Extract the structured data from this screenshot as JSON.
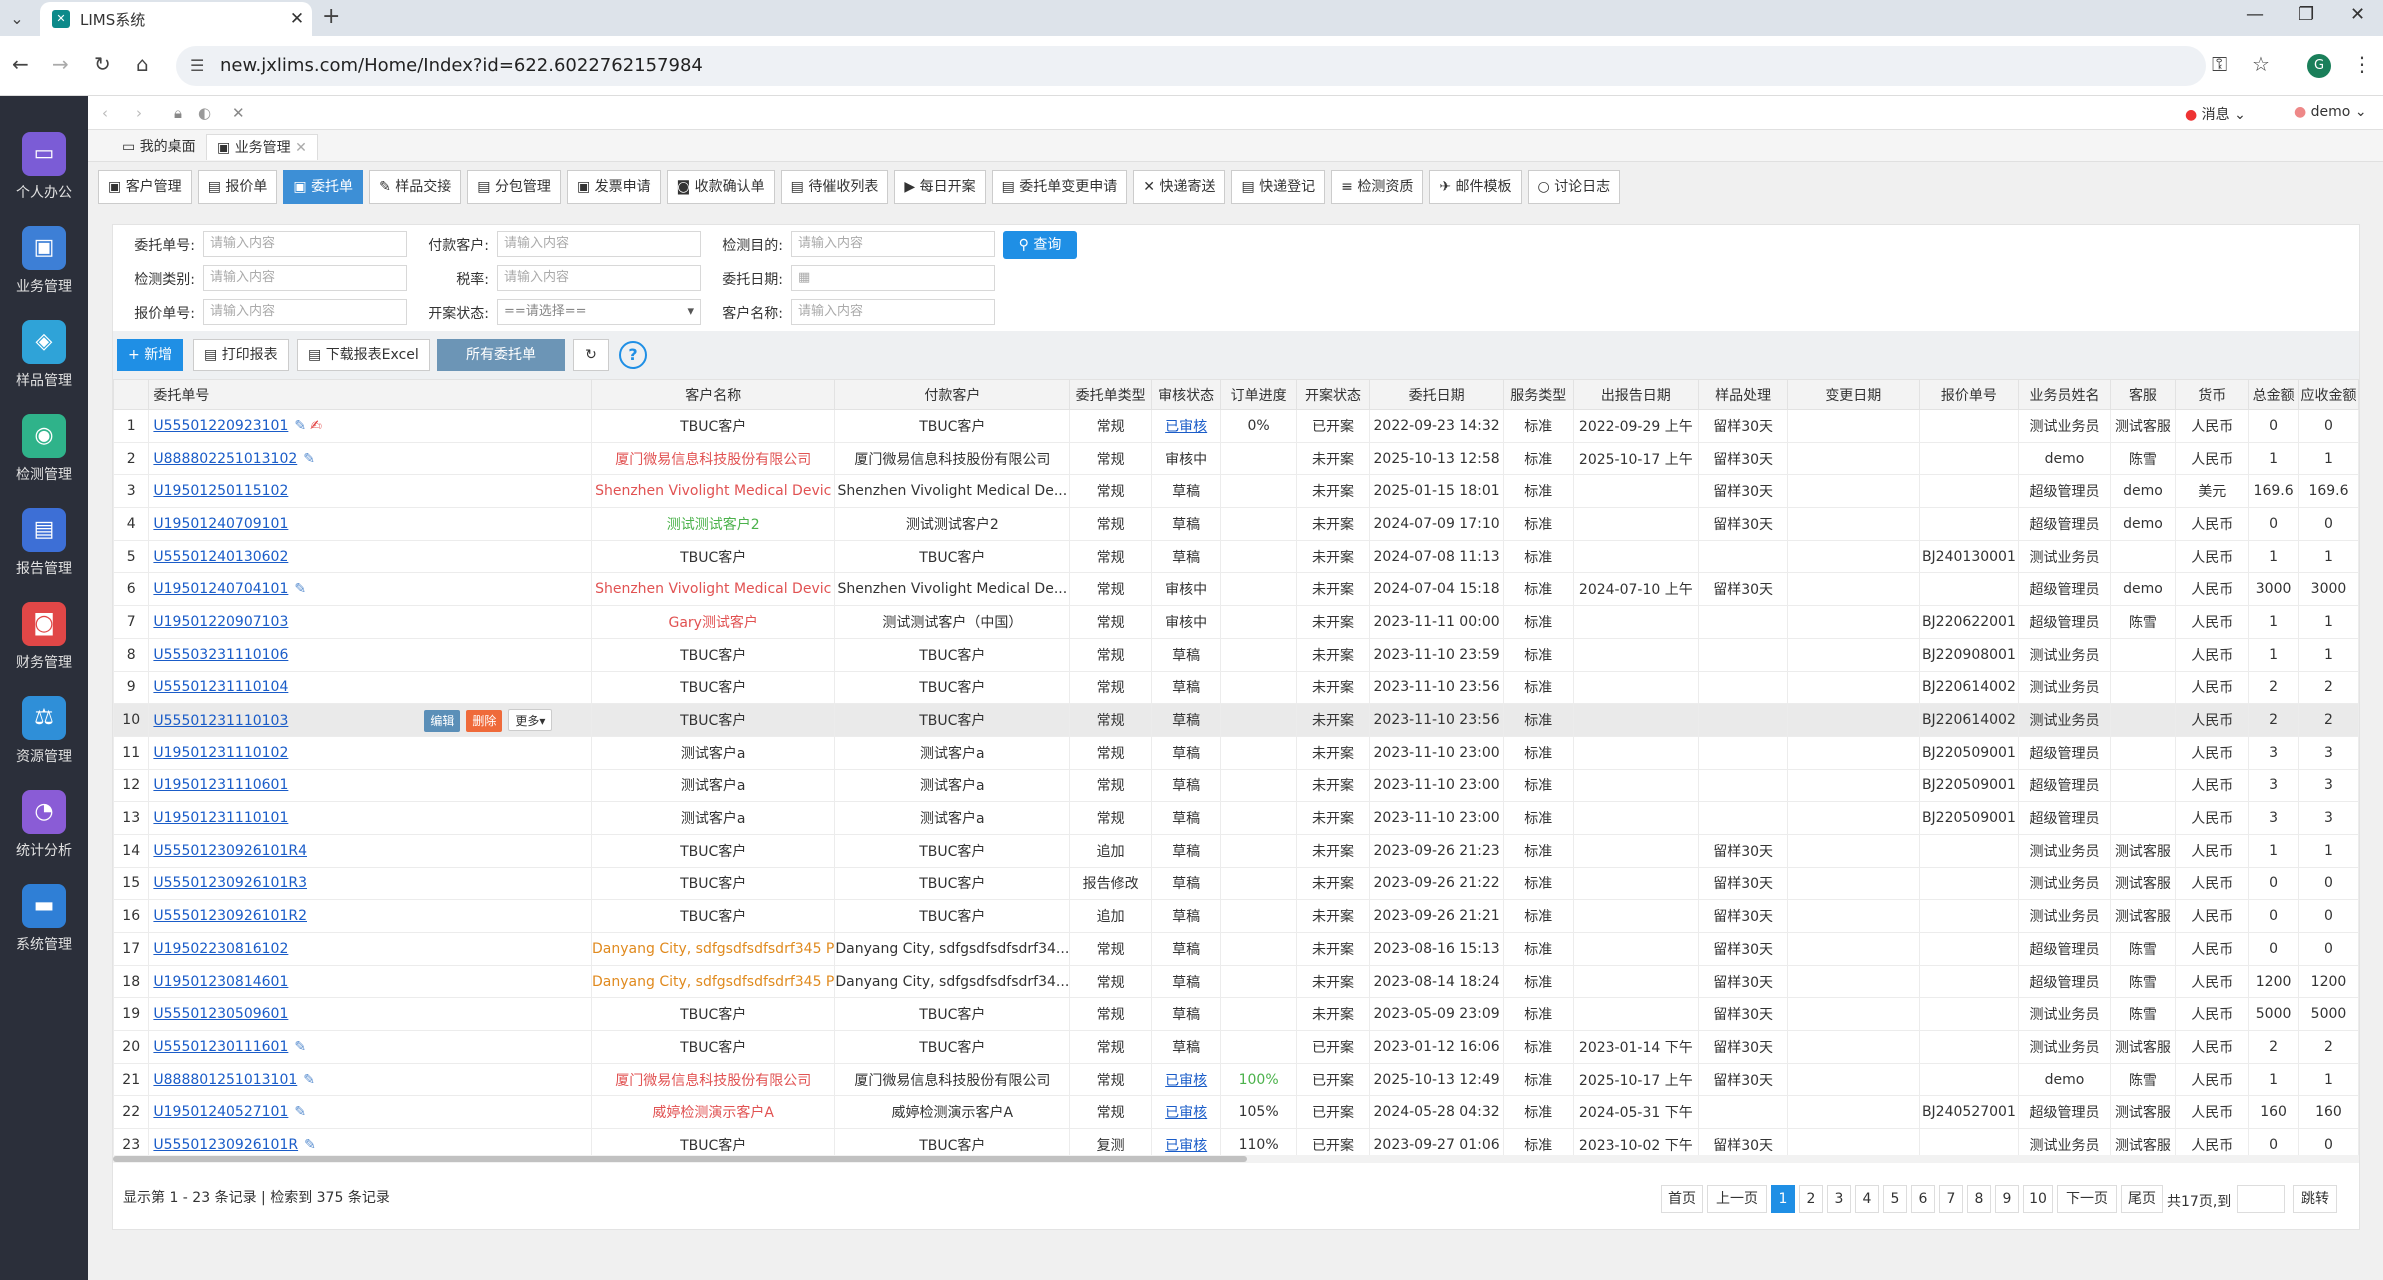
{
  "browser": {
    "tab_title": "LIMS系统",
    "url": "new.jxlims.com/Home/Index?id=622.6022762157984"
  },
  "header": {
    "messages": "消息",
    "user": "demo"
  },
  "sidebar": [
    {
      "label": "个人办公",
      "color": "#7b5cd6"
    },
    {
      "label": "业务管理",
      "color": "#3d7fd6"
    },
    {
      "label": "样品管理",
      "color": "#2fa3d8"
    },
    {
      "label": "检测管理",
      "color": "#2fb38a"
    },
    {
      "label": "报告管理",
      "color": "#3d6fd6"
    },
    {
      "label": "财务管理",
      "color": "#e14747"
    },
    {
      "label": "资源管理",
      "color": "#2f8fd8"
    },
    {
      "label": "统计分析",
      "color": "#8a5cd6"
    },
    {
      "label": "系统管理",
      "color": "#2f7fd6"
    }
  ],
  "page_tabs": [
    "我的桌面",
    "业务管理"
  ],
  "module_tabs": [
    "客户管理",
    "报价单",
    "委托单",
    "样品交接",
    "分包管理",
    "发票申请",
    "收款确认单",
    "待催收列表",
    "每日开案",
    "委托单变更申请",
    "快递寄送",
    "快递登记",
    "检测资质",
    "邮件模板",
    "讨论日志"
  ],
  "filters": {
    "f1": {
      "label": "委托单号:",
      "placeholder": "请输入内容"
    },
    "f2": {
      "label": "付款客户:",
      "placeholder": "请输入内容"
    },
    "f3": {
      "label": "检测目的:",
      "placeholder": "请输入内容"
    },
    "f4": {
      "label": "检测类别:",
      "placeholder": "请输入内容"
    },
    "f5": {
      "label": "税率:",
      "placeholder": "请输入内容"
    },
    "f6": {
      "label": "委托日期:"
    },
    "f7": {
      "label": "报价单号:",
      "placeholder": "请输入内容"
    },
    "f8": {
      "label": "开案状态:",
      "value": "==请选择=="
    },
    "f9": {
      "label": "客户名称:",
      "placeholder": "请输入内容"
    },
    "query": "查询"
  },
  "toolbar": {
    "add": "新增",
    "print": "打印报表",
    "excel": "下载报表Excel",
    "all": "所有委托单"
  },
  "columns": [
    "委托单号",
    "客户名称",
    "付款客户",
    "委托单类型",
    "审核状态",
    "订单进度",
    "开案状态",
    "委托日期",
    "服务类型",
    "出报告日期",
    "样品处理",
    "变更日期",
    "报价单号",
    "业务员姓名",
    "客服",
    "货币",
    "总金额",
    "应收金额"
  ],
  "rows": [
    {
      "i": "1",
      "id": "U55501220923101",
      "pen": true,
      "edit": true,
      "cust": "TBUC客户",
      "cc": "",
      "pay": "TBUC客户",
      "type": "常规",
      "audit": "已审核",
      "al": true,
      "prog": "0%",
      "pc": "",
      "case": "已开案",
      "date": "2022-09-23 14:32",
      "svc": "标准",
      "rep": "2022-09-29 上午",
      "samp": "留样30天",
      "chg": "",
      "quote": "",
      "sales": "测试业务员",
      "cs": "测试客服",
      "cur": "人民币",
      "total": "0",
      "recv": "0"
    },
    {
      "i": "2",
      "id": "U888802251013102",
      "pen": true,
      "cust": "厦门微易信息科技股份有限公司",
      "cc": "red",
      "pay": "厦门微易信息科技股份有限公司",
      "type": "常规",
      "audit": "审核中",
      "prog": "",
      "case": "未开案",
      "date": "2025-10-13 12:58",
      "svc": "标准",
      "rep": "2025-10-17 上午",
      "samp": "留样30天",
      "chg": "",
      "quote": "",
      "sales": "demo",
      "cs": "陈雪",
      "cur": "人民币",
      "total": "1",
      "recv": "1"
    },
    {
      "i": "3",
      "id": "U19501250115102",
      "cust": "Shenzhen Vivolight Medical Devic",
      "cc": "red",
      "pay": "Shenzhen Vivolight Medical De...",
      "type": "常规",
      "audit": "草稿",
      "prog": "",
      "case": "未开案",
      "date": "2025-01-15 18:01",
      "svc": "标准",
      "rep": "",
      "samp": "留样30天",
      "chg": "",
      "quote": "",
      "sales": "超级管理员",
      "cs": "demo",
      "cur": "美元",
      "total": "169.6",
      "recv": "169.6"
    },
    {
      "i": "4",
      "id": "U19501240709101",
      "cust": "测试测试客户2",
      "cc": "grn",
      "pay": "测试测试客户2",
      "type": "常规",
      "audit": "草稿",
      "prog": "",
      "case": "未开案",
      "date": "2024-07-09 17:10",
      "svc": "标准",
      "rep": "",
      "samp": "留样30天",
      "chg": "",
      "quote": "",
      "sales": "超级管理员",
      "cs": "demo",
      "cur": "人民币",
      "total": "0",
      "recv": "0"
    },
    {
      "i": "5",
      "id": "U55501240130602",
      "cust": "TBUC客户",
      "cc": "",
      "pay": "TBUC客户",
      "type": "常规",
      "audit": "草稿",
      "prog": "",
      "case": "未开案",
      "date": "2024-07-08 11:13",
      "svc": "标准",
      "rep": "",
      "samp": "",
      "chg": "",
      "quote": "BJ240130001",
      "sales": "测试业务员",
      "cs": "",
      "cur": "人民币",
      "total": "1",
      "recv": "1"
    },
    {
      "i": "6",
      "id": "U19501240704101",
      "pen": true,
      "cust": "Shenzhen Vivolight Medical Devic",
      "cc": "red",
      "pay": "Shenzhen Vivolight Medical De...",
      "type": "常规",
      "audit": "审核中",
      "prog": "",
      "case": "未开案",
      "date": "2024-07-04 15:18",
      "svc": "标准",
      "rep": "2024-07-10 上午",
      "samp": "留样30天",
      "chg": "",
      "quote": "",
      "sales": "超级管理员",
      "cs": "demo",
      "cur": "人民币",
      "total": "3000",
      "recv": "3000"
    },
    {
      "i": "7",
      "id": "U19501220907103",
      "cust": "Gary测试客户",
      "cc": "red",
      "pay": "测试测试客户（中国）",
      "type": "常规",
      "audit": "审核中",
      "prog": "",
      "case": "未开案",
      "date": "2023-11-11 00:00",
      "svc": "标准",
      "rep": "",
      "samp": "",
      "chg": "",
      "quote": "BJ220622001",
      "sales": "超级管理员",
      "cs": "陈雪",
      "cur": "人民币",
      "total": "1",
      "recv": "1"
    },
    {
      "i": "8",
      "id": "U55503231110106",
      "cust": "TBUC客户",
      "cc": "",
      "pay": "TBUC客户",
      "type": "常规",
      "audit": "草稿",
      "prog": "",
      "case": "未开案",
      "date": "2023-11-10 23:59",
      "svc": "标准",
      "rep": "",
      "samp": "",
      "chg": "",
      "quote": "BJ220908001",
      "sales": "测试业务员",
      "cs": "",
      "cur": "人民币",
      "total": "1",
      "recv": "1"
    },
    {
      "i": "9",
      "id": "U55501231110104",
      "cust": "TBUC客户",
      "cc": "",
      "pay": "TBUC客户",
      "type": "常规",
      "audit": "草稿",
      "prog": "",
      "case": "未开案",
      "date": "2023-11-10 23:56",
      "svc": "标准",
      "rep": "",
      "samp": "",
      "chg": "",
      "quote": "BJ220614002",
      "sales": "测试业务员",
      "cs": "",
      "cur": "人民币",
      "total": "2",
      "recv": "2"
    },
    {
      "i": "10",
      "id": "U55501231110103",
      "hl": true,
      "cust": "TBUC客户",
      "cc": "",
      "pay": "TBUC客户",
      "type": "常规",
      "audit": "草稿",
      "prog": "",
      "case": "未开案",
      "date": "2023-11-10 23:56",
      "svc": "标准",
      "rep": "",
      "samp": "",
      "chg": "",
      "quote": "BJ220614002",
      "sales": "测试业务员",
      "cs": "",
      "cur": "人民币",
      "total": "2",
      "recv": "2"
    },
    {
      "i": "11",
      "id": "U19501231110102",
      "cust": "测试客户a",
      "cc": "",
      "pay": "测试客户a",
      "type": "常规",
      "audit": "草稿",
      "prog": "",
      "case": "未开案",
      "date": "2023-11-10 23:00",
      "svc": "标准",
      "rep": "",
      "samp": "",
      "chg": "",
      "quote": "BJ220509001",
      "sales": "超级管理员",
      "cs": "",
      "cur": "人民币",
      "total": "3",
      "recv": "3"
    },
    {
      "i": "12",
      "id": "U19501231110601",
      "cust": "测试客户a",
      "cc": "",
      "pay": "测试客户a",
      "type": "常规",
      "audit": "草稿",
      "prog": "",
      "case": "未开案",
      "date": "2023-11-10 23:00",
      "svc": "标准",
      "rep": "",
      "samp": "",
      "chg": "",
      "quote": "BJ220509001",
      "sales": "超级管理员",
      "cs": "",
      "cur": "人民币",
      "total": "3",
      "recv": "3"
    },
    {
      "i": "13",
      "id": "U19501231110101",
      "cust": "测试客户a",
      "cc": "",
      "pay": "测试客户a",
      "type": "常规",
      "audit": "草稿",
      "prog": "",
      "case": "未开案",
      "date": "2023-11-10 23:00",
      "svc": "标准",
      "rep": "",
      "samp": "",
      "chg": "",
      "quote": "BJ220509001",
      "sales": "超级管理员",
      "cs": "",
      "cur": "人民币",
      "total": "3",
      "recv": "3"
    },
    {
      "i": "14",
      "id": "U55501230926101R4",
      "cust": "TBUC客户",
      "cc": "",
      "pay": "TBUC客户",
      "type": "追加",
      "audit": "草稿",
      "prog": "",
      "case": "未开案",
      "date": "2023-09-26 21:23",
      "svc": "标准",
      "rep": "",
      "samp": "留样30天",
      "chg": "",
      "quote": "",
      "sales": "测试业务员",
      "cs": "测试客服",
      "cur": "人民币",
      "total": "1",
      "recv": "1"
    },
    {
      "i": "15",
      "id": "U55501230926101R3",
      "cust": "TBUC客户",
      "cc": "",
      "pay": "TBUC客户",
      "type": "报告修改",
      "audit": "草稿",
      "prog": "",
      "case": "未开案",
      "date": "2023-09-26 21:22",
      "svc": "标准",
      "rep": "",
      "samp": "留样30天",
      "chg": "",
      "quote": "",
      "sales": "测试业务员",
      "cs": "测试客服",
      "cur": "人民币",
      "total": "0",
      "recv": "0"
    },
    {
      "i": "16",
      "id": "U55501230926101R2",
      "cust": "TBUC客户",
      "cc": "",
      "pay": "TBUC客户",
      "type": "追加",
      "audit": "草稿",
      "prog": "",
      "case": "未开案",
      "date": "2023-09-26 21:21",
      "svc": "标准",
      "rep": "",
      "samp": "留样30天",
      "chg": "",
      "quote": "",
      "sales": "测试业务员",
      "cs": "测试客服",
      "cur": "人民币",
      "total": "0",
      "recv": "0"
    },
    {
      "i": "17",
      "id": "U19502230816102",
      "cust": "Danyang City, sdfgsdfsdfsdrf345 P",
      "cc": "org",
      "pay": "Danyang City, sdfgsdfsdfsdrf34...",
      "type": "常规",
      "audit": "草稿",
      "prog": "",
      "case": "未开案",
      "date": "2023-08-16 15:13",
      "svc": "标准",
      "rep": "",
      "samp": "留样30天",
      "chg": "",
      "quote": "",
      "sales": "超级管理员",
      "cs": "陈雪",
      "cur": "人民币",
      "total": "0",
      "recv": "0"
    },
    {
      "i": "18",
      "id": "U19501230814601",
      "cust": "Danyang City, sdfgsdfsdfsdrf345 P",
      "cc": "org",
      "pay": "Danyang City, sdfgsdfsdfsdrf34...",
      "type": "常规",
      "audit": "草稿",
      "prog": "",
      "case": "未开案",
      "date": "2023-08-14 18:24",
      "svc": "标准",
      "rep": "",
      "samp": "留样30天",
      "chg": "",
      "quote": "",
      "sales": "超级管理员",
      "cs": "陈雪",
      "cur": "人民币",
      "total": "1200",
      "recv": "1200"
    },
    {
      "i": "19",
      "id": "U55501230509601",
      "cust": "TBUC客户",
      "cc": "",
      "pay": "TBUC客户",
      "type": "常规",
      "audit": "草稿",
      "prog": "",
      "case": "未开案",
      "date": "2023-05-09 23:09",
      "svc": "标准",
      "rep": "",
      "samp": "留样30天",
      "chg": "",
      "quote": "",
      "sales": "测试业务员",
      "cs": "陈雪",
      "cur": "人民币",
      "total": "5000",
      "recv": "5000"
    },
    {
      "i": "20",
      "id": "U55501230111601",
      "pen": true,
      "cust": "TBUC客户",
      "cc": "",
      "pay": "TBUC客户",
      "type": "常规",
      "audit": "草稿",
      "prog": "",
      "case": "已开案",
      "date": "2023-01-12 16:06",
      "svc": "标准",
      "rep": "2023-01-14 下午",
      "samp": "留样30天",
      "chg": "",
      "quote": "",
      "sales": "测试业务员",
      "cs": "测试客服",
      "cur": "人民币",
      "total": "2",
      "recv": "2"
    },
    {
      "i": "21",
      "id": "U888801251013101",
      "pen": true,
      "cust": "厦门微易信息科技股份有限公司",
      "cc": "red",
      "pay": "厦门微易信息科技股份有限公司",
      "type": "常规",
      "audit": "已审核",
      "al": true,
      "prog": "100%",
      "pc": "grn",
      "case": "已开案",
      "date": "2025-10-13 12:49",
      "svc": "标准",
      "rep": "2025-10-17 上午",
      "samp": "留样30天",
      "chg": "",
      "quote": "",
      "sales": "demo",
      "cs": "陈雪",
      "cur": "人民币",
      "total": "1",
      "recv": "1"
    },
    {
      "i": "22",
      "id": "U19501240527101",
      "pen": true,
      "cust": "威婷检测演示客户A",
      "cc": "red",
      "pay": "威婷检测演示客户A",
      "type": "常规",
      "audit": "已审核",
      "al": true,
      "prog": "105%",
      "pc": "",
      "case": "已开案",
      "date": "2024-05-28 04:32",
      "svc": "标准",
      "rep": "2024-05-31 下午",
      "samp": "",
      "chg": "",
      "quote": "BJ240527001",
      "sales": "超级管理员",
      "cs": "测试客服",
      "cur": "人民币",
      "total": "160",
      "recv": "160"
    },
    {
      "i": "23",
      "id": "U55501230926101R",
      "pen": true,
      "cust": "TBUC客户",
      "cc": "",
      "pay": "TBUC客户",
      "type": "复测",
      "audit": "已审核",
      "al": true,
      "prog": "110%",
      "pc": "",
      "case": "已开案",
      "date": "2023-09-27 01:06",
      "svc": "标准",
      "rep": "2023-10-02 下午",
      "samp": "留样30天",
      "chg": "",
      "quote": "",
      "sales": "测试业务员",
      "cs": "测试客服",
      "cur": "人民币",
      "total": "0",
      "recv": "0"
    }
  ],
  "row_actions": {
    "edit": "编辑",
    "delete": "删除",
    "more": "更多"
  },
  "footer": {
    "info": "显示第 1 - 23 条记录 | 检索到 375 条记录",
    "first": "首页",
    "prev": "上一页",
    "pages": [
      "1",
      "2",
      "3",
      "4",
      "5",
      "6",
      "7",
      "8",
      "9",
      "10"
    ],
    "next": "下一页",
    "last": "尾页",
    "total": "共17页,到",
    "jump": "跳转"
  }
}
